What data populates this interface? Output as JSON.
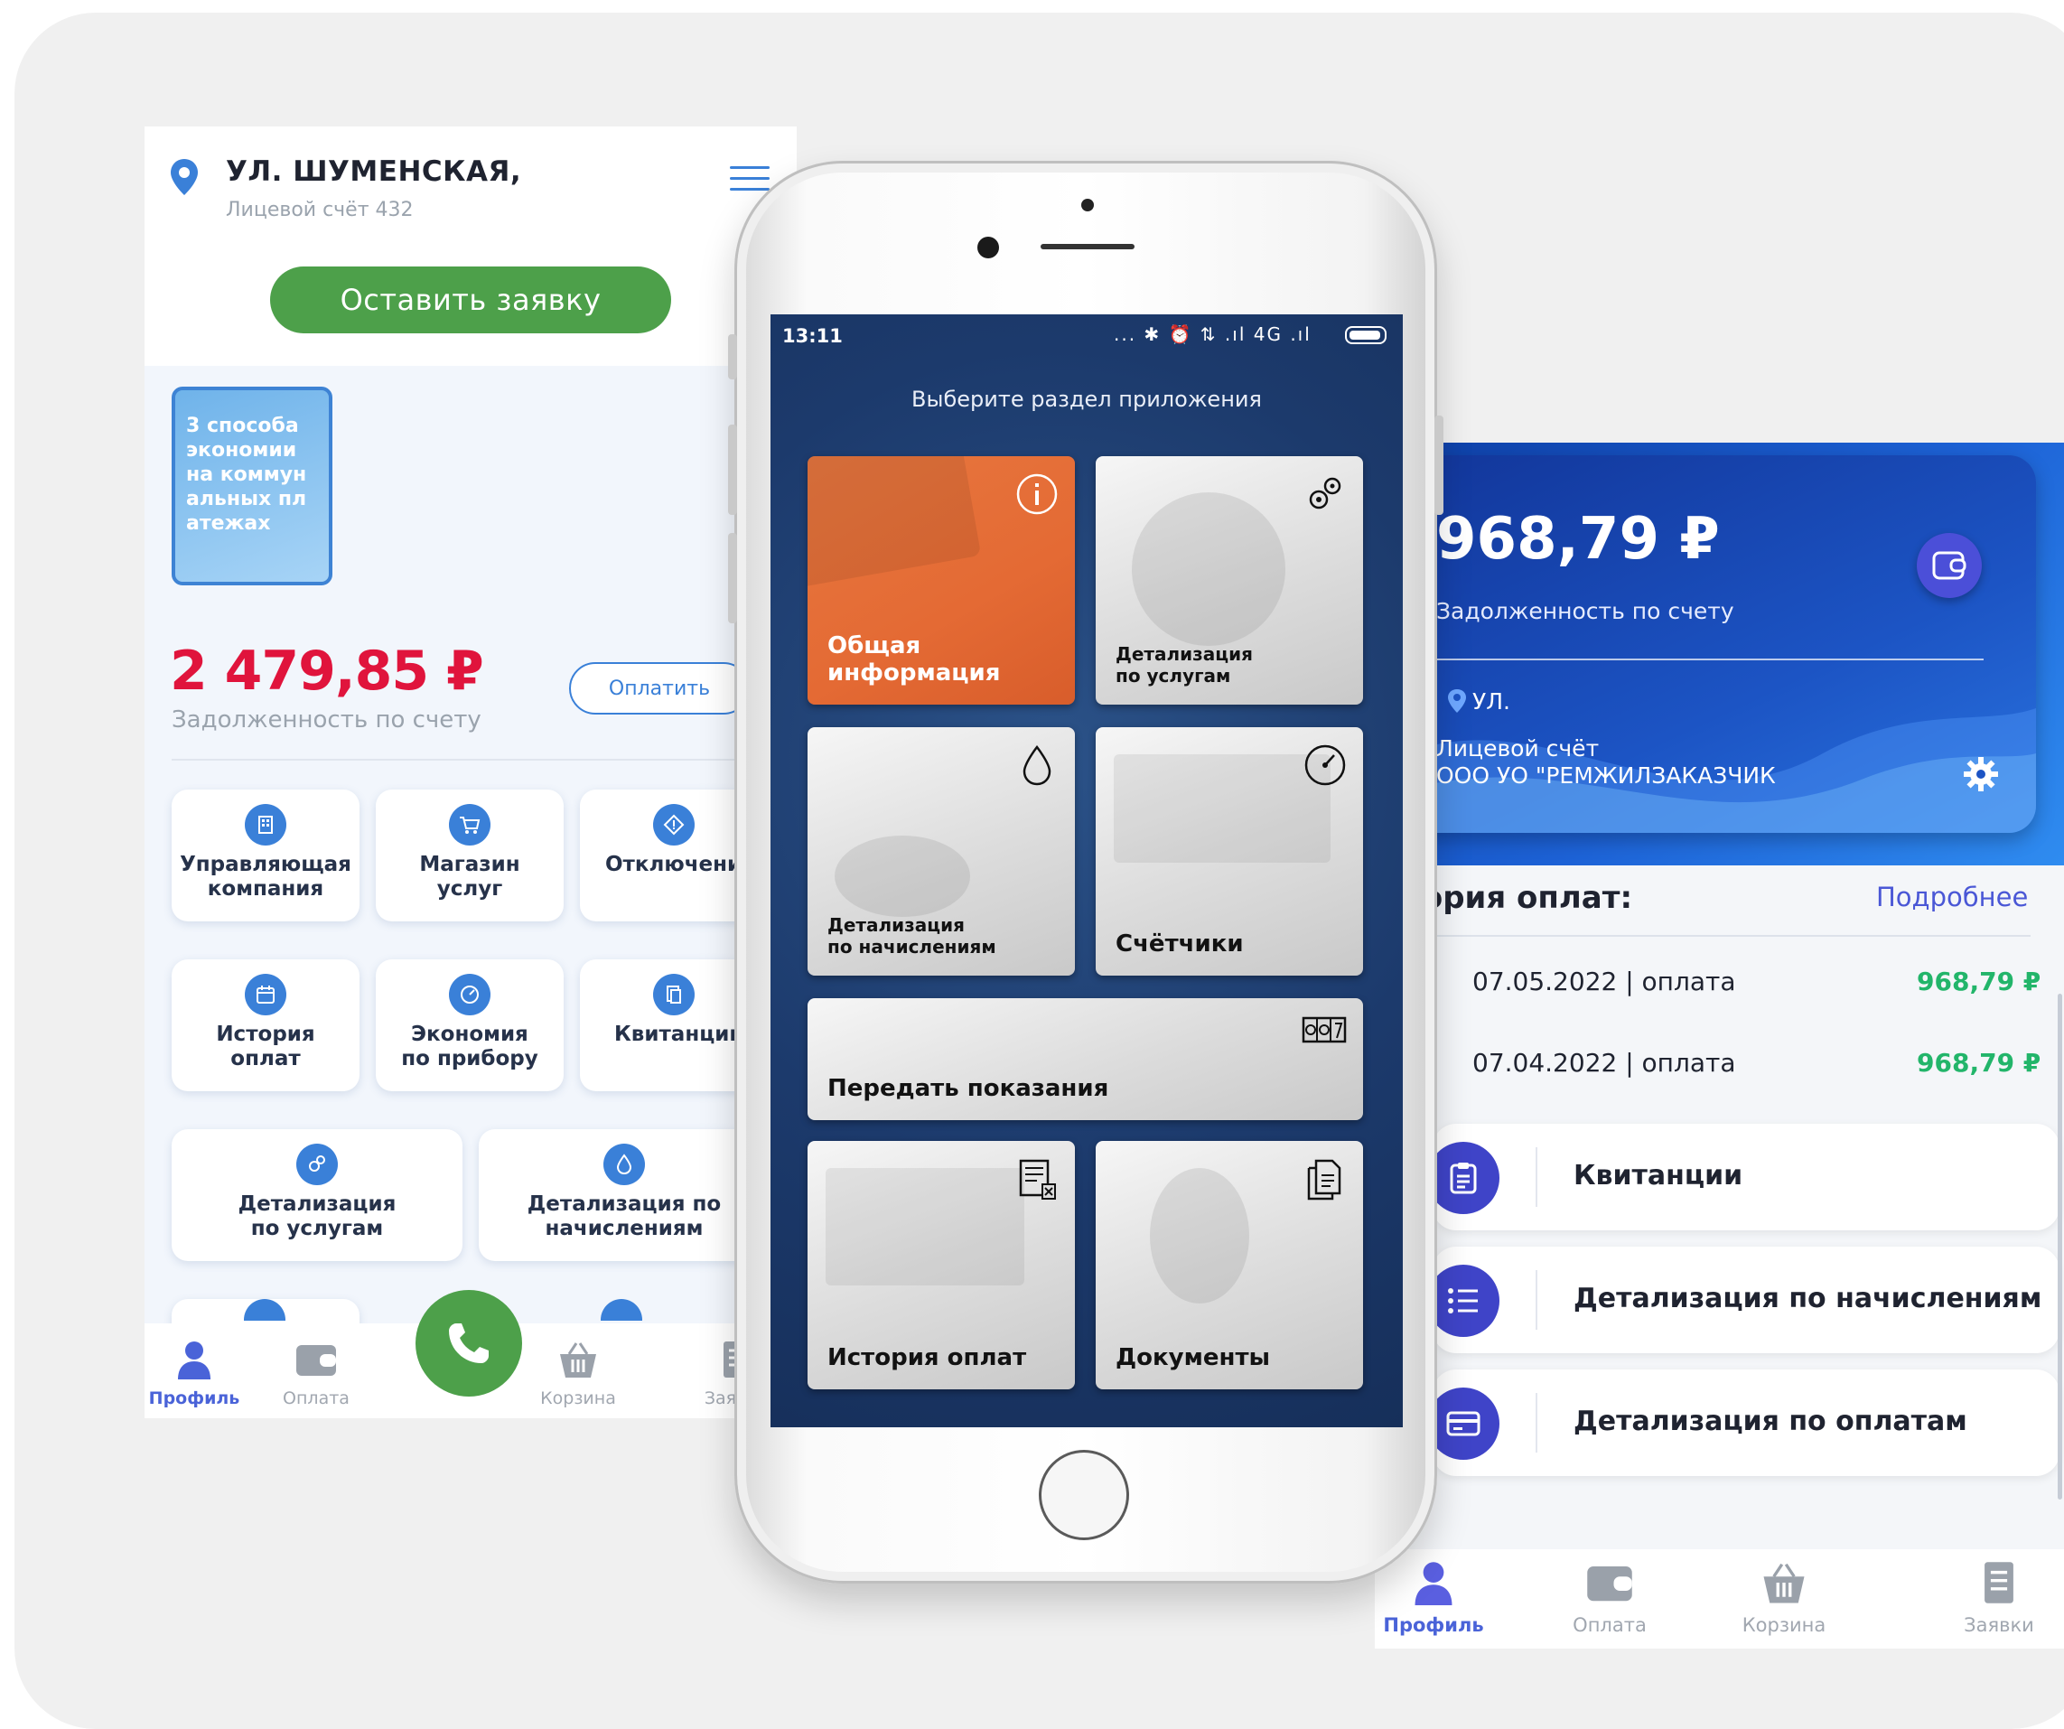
{
  "left_app": {
    "address": "УЛ. ШУМЕНСКАЯ,",
    "account": "Лицевой счёт 432",
    "request_button": "Оставить заявку",
    "promo": "3 способа экономии на коммунальных платежах",
    "debt_amount": "2 479,85 ₽",
    "debt_label": "Задолженность по счету",
    "pay_button": "Оплатить",
    "tiles": [
      {
        "label": "Управляющая\nкомпания",
        "icon": "building-icon"
      },
      {
        "label": "Магазин\nуслуг",
        "icon": "cart-icon"
      },
      {
        "label": "Отключения",
        "icon": "alert-diamond-icon"
      },
      {
        "label": "История\nоплат",
        "icon": "calendar-icon"
      },
      {
        "label": "Экономия\nпо прибору",
        "icon": "gauge-icon"
      },
      {
        "label": "Квитанции",
        "icon": "documents-icon"
      },
      {
        "label": "Детализация\nпо услугам",
        "icon": "gears-icon"
      },
      {
        "label": "Детализация по\nначислениям",
        "icon": "drop-icon"
      }
    ],
    "nav": [
      {
        "label": "Профиль",
        "icon": "profile-icon",
        "active": true
      },
      {
        "label": "Оплата",
        "icon": "wallet-icon"
      },
      {
        "label": "Корзина",
        "icon": "basket-icon"
      },
      {
        "label": "Заявки",
        "icon": "requests-icon"
      }
    ],
    "call_icon": "phone-icon"
  },
  "phone_app": {
    "status_time": "13:11",
    "status_icons": "... ✱ ⏰ ⇅ .ıl 4G .ıl",
    "title": "Выберите раздел приложения",
    "tiles": [
      {
        "label": "Общая\nинформация",
        "icon": "info-icon"
      },
      {
        "label": "Детализация\nпо услугам",
        "icon": "gears-icon"
      },
      {
        "label": "Детализация\nпо начислениям",
        "icon": "drop-icon"
      },
      {
        "label": "Счётчики",
        "icon": "gauge-icon"
      },
      {
        "label": "Передать показания",
        "icon": "meter-counter-icon"
      },
      {
        "label": "История оплат",
        "icon": "receipt-icon"
      },
      {
        "label": "Документы",
        "icon": "documents-icon"
      }
    ]
  },
  "right_app": {
    "amount": "968,79 ₽",
    "debt_label": "Задолженность по счету",
    "address": "УЛ.",
    "account_line1": "Лицевой счёт",
    "account_line2": "ООО УО \"РЕМЖИЛЗАКАЗЧИК",
    "history_title": "стория оплат:",
    "history_more": "Подробнее",
    "payments": [
      {
        "text": "07.05.2022 | оплата",
        "sum": "968,79 ₽"
      },
      {
        "text": "07.04.2022 | оплата",
        "sum": "968,79 ₽"
      }
    ],
    "menu": [
      {
        "label": "Квитанции",
        "icon": "clipboard-icon"
      },
      {
        "label": "Детализация по начислениям",
        "icon": "list-icon"
      },
      {
        "label": "Детализация по оплатам",
        "icon": "card-icon"
      }
    ],
    "nav": [
      {
        "label": "Профиль",
        "icon": "profile-icon",
        "active": true
      },
      {
        "label": "Оплата",
        "icon": "wallet-icon"
      },
      {
        "label": "Корзина",
        "icon": "basket-icon"
      },
      {
        "label": "Заявки",
        "icon": "requests-icon"
      }
    ]
  },
  "colors": {
    "green": "#4da04a",
    "red_amount": "#e0143c",
    "accent_blue": "#3a80d8",
    "indigo": "#3f44c8",
    "pay_green": "#22b56a",
    "orange_tile": "#e46a34"
  }
}
